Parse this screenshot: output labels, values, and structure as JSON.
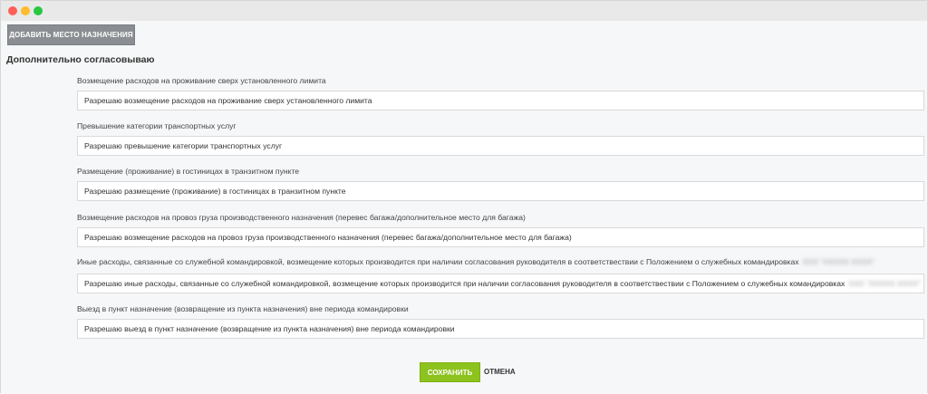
{
  "toolbar": {
    "add_destination_label": "ДОБАВИТЬ МЕСТО НАЗНАЧЕНИЯ"
  },
  "section": {
    "title": "Дополнительно согласовываю"
  },
  "fields": [
    {
      "label": "Возмещение расходов на проживание сверх установленного лимита",
      "value": "Разрешаю возмещение расходов на проживание сверх установленного лимита"
    },
    {
      "label": "Превышение категории транспортных услуг",
      "value": "Разрешаю превышение категории транспортных услуг"
    },
    {
      "label": "Размещение (проживание) в гостиницах в транзитном пункте",
      "value": "Разрешаю размещение (проживание) в гостиницах в транзитном пункте"
    },
    {
      "label": "Возмещение расходов на провоз груза производственного назначения (перевес багажа/дополнительное место для багажа)",
      "value": "Разрешаю возмещение расходов на провоз груза производственного назначения (перевес багажа/дополнительное место для багажа)"
    },
    {
      "label": "Иные расходы, связанные со служебной командировкой, возмещение которых производится при наличии согласования руководителя в соответствествии с Положением о служебных командировках",
      "value": "Разрешаю иные расходы, связанные со служебной командировкой, возмещение которых производится при наличии согласования руководителя в соответствествии с Положением о служебных командировках"
    },
    {
      "label": "Выезд в пункт назначение (возвращение из пункта назначения) вне периода командировки",
      "value": "Разрешаю выезд в пункт назначение (возвращение из пункта назначения) вне периода командировки"
    }
  ],
  "footer": {
    "save_label": "СОХРАНИТЬ",
    "cancel_label": "ОТМЕНА"
  }
}
